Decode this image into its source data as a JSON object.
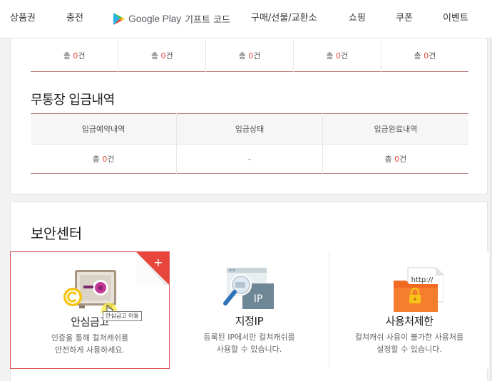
{
  "nav": {
    "items": [
      "상품권",
      "충전",
      "구매/선물/교환소",
      "쇼핑",
      "쿠폰",
      "이벤트"
    ],
    "google_play": {
      "brand": "Google Play",
      "suffix": "기프트 코드",
      "icon": "google-play-logo-icon"
    }
  },
  "summary_row": {
    "cells": [
      {
        "prefix": "총 ",
        "count": "0",
        "suffix": "건"
      },
      {
        "prefix": "총 ",
        "count": "0",
        "suffix": "건"
      },
      {
        "prefix": "총 ",
        "count": "0",
        "suffix": "건"
      },
      {
        "prefix": "총 ",
        "count": "0",
        "suffix": "건"
      },
      {
        "prefix": "총 ",
        "count": "0",
        "suffix": "건"
      }
    ]
  },
  "deposit": {
    "title": "무통장 입금내역",
    "headers": [
      "입금예약내역",
      "입금상태",
      "입금완료내역"
    ],
    "row": {
      "reserved": {
        "prefix": "총 ",
        "count": "0",
        "suffix": "건"
      },
      "status": "-",
      "completed": {
        "prefix": "총 ",
        "count": "0",
        "suffix": "건"
      }
    }
  },
  "security": {
    "title": "보안센터",
    "cards": [
      {
        "title": "안심금고",
        "desc_line1": "인증을 통해 컬쳐캐쉬를",
        "desc_line2": "안전하게 사용하세요.",
        "icon": "safe-vault-icon",
        "ribbon": "+"
      },
      {
        "title": "지정IP",
        "desc_line1": "등록된 IP에서만 컬쳐캐쉬를",
        "desc_line2": "사용할 수 있습니다.",
        "icon": "designated-ip-icon",
        "ip_label": "IP"
      },
      {
        "title": "사용처제한",
        "desc_line1": "컬쳐캐쉬 사용이 불가한 사용처를",
        "desc_line2": "설정할 수 있습니다.",
        "icon": "usage-restriction-icon",
        "http_label": "http://"
      }
    ],
    "tooltip": "안심금고 이동"
  },
  "colors": {
    "accent_red": "#e2483d",
    "border_red": "#d9534f",
    "table_rule": "#b97b7b"
  }
}
